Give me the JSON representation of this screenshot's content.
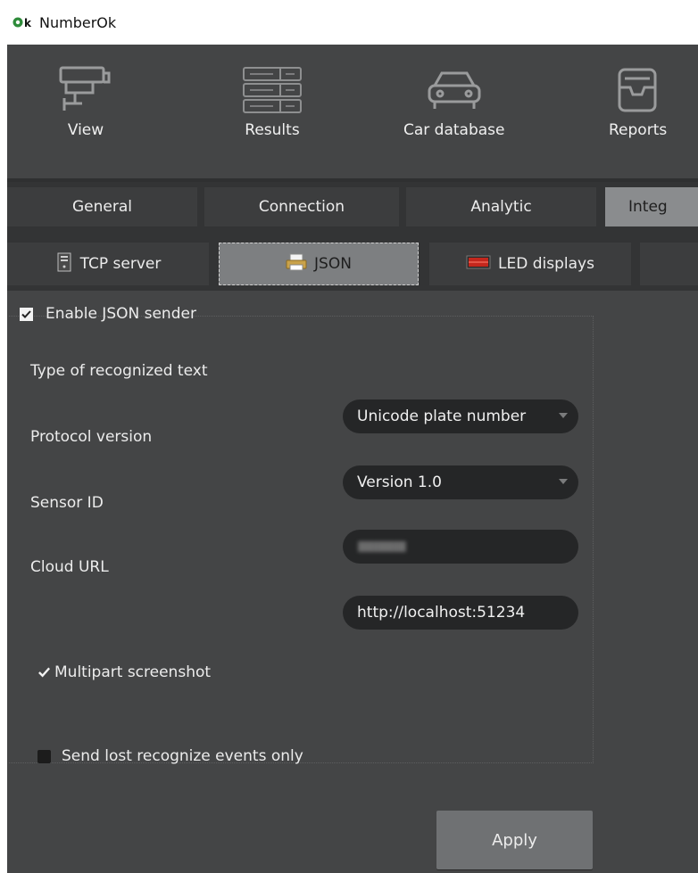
{
  "window": {
    "title": "NumberOk",
    "icon": "numberok-logo-icon"
  },
  "toolbar": {
    "items": [
      {
        "label": "View",
        "icon": "camera-icon"
      },
      {
        "label": "Results",
        "icon": "plate-list-icon"
      },
      {
        "label": "Car database",
        "icon": "car-icon"
      },
      {
        "label": "Reports",
        "icon": "tray-icon"
      }
    ]
  },
  "tabs": [
    {
      "label": "General",
      "active": false
    },
    {
      "label": "Connection",
      "active": false
    },
    {
      "label": "Analytic",
      "active": false
    },
    {
      "label": "Integ",
      "active": true
    }
  ],
  "subtabs": [
    {
      "label": "TCP server",
      "icon": "server-icon",
      "active": false
    },
    {
      "label": "JSON",
      "icon": "json-icon",
      "active": true
    },
    {
      "label": "LED displays",
      "icon": "led-display-icon",
      "active": false
    },
    {
      "label": "",
      "active": false
    }
  ],
  "json_settings": {
    "enable_label": "Enable JSON sender",
    "enable_checked": true,
    "text_type_label": "Type of recognized text",
    "text_type_value": "Unicode plate number",
    "protocol_label": "Protocol version",
    "protocol_value": "Version 1.0",
    "sensor_label": "Sensor ID",
    "sensor_value": "llllllllllllllllllllll",
    "cloud_label": "Cloud URL",
    "cloud_value": "http://localhost:51234",
    "multipart_label": "Multipart screenshot",
    "multipart_checked": true,
    "lost_only_label": "Send lost recognize events only",
    "lost_only_checked": false,
    "apply_label": "Apply"
  },
  "colors": {
    "background": "#444546",
    "tab_bar": "#333435",
    "active_tab": "#8a8c8e",
    "field_bg": "#252627",
    "button": "#6f7173"
  }
}
